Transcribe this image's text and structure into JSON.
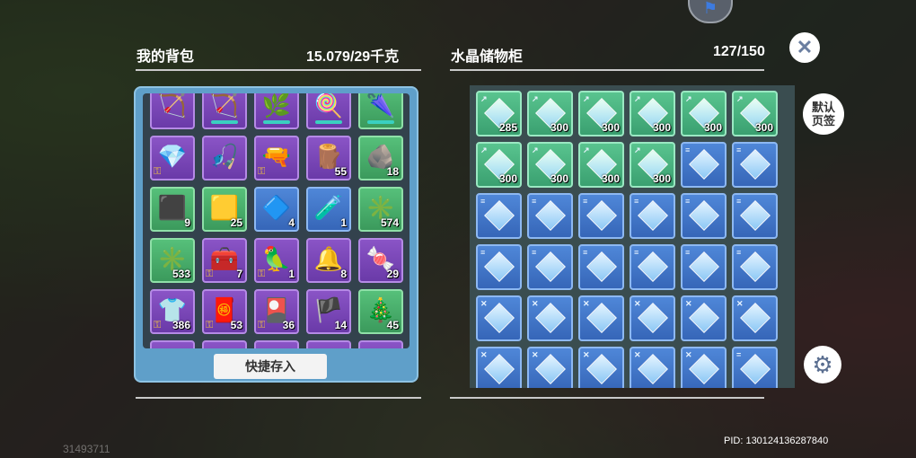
{
  "backpack": {
    "title": "我的背包",
    "weight": "15.079/29千克",
    "quick_store_label": "快捷存入",
    "items": [
      {
        "icon": "🏹",
        "color": "purple",
        "count": "",
        "bar": false
      },
      {
        "icon": "🏹",
        "color": "purple",
        "count": "",
        "bar": true
      },
      {
        "icon": "🌿",
        "color": "purple",
        "count": "",
        "bar": true
      },
      {
        "icon": "🍭",
        "color": "purple",
        "count": "",
        "bar": true
      },
      {
        "icon": "🌂",
        "color": "green",
        "count": "",
        "bar": true
      },
      {
        "icon": "💎",
        "color": "purple",
        "count": "",
        "bar": false,
        "lock": true
      },
      {
        "icon": "🎣",
        "color": "purple",
        "count": "",
        "bar": false
      },
      {
        "icon": "🔫",
        "color": "purple",
        "count": "",
        "bar": false,
        "lock": true
      },
      {
        "icon": "🪵",
        "color": "purple",
        "count": "55",
        "bar": false
      },
      {
        "icon": "🪨",
        "color": "green",
        "count": "18",
        "bar": false
      },
      {
        "icon": "⬛",
        "color": "green",
        "count": "9",
        "bar": false
      },
      {
        "icon": "🟨",
        "color": "green",
        "count": "25",
        "bar": false
      },
      {
        "icon": "🔷",
        "color": "blue",
        "count": "4",
        "bar": false
      },
      {
        "icon": "🧪",
        "color": "blue",
        "count": "1",
        "bar": false
      },
      {
        "icon": "✳️",
        "color": "green",
        "count": "574",
        "bar": false
      },
      {
        "icon": "✳️",
        "color": "green",
        "count": "533",
        "bar": false
      },
      {
        "icon": "🧰",
        "color": "purple",
        "count": "7",
        "bar": false,
        "lock": true
      },
      {
        "icon": "🦜",
        "color": "purple",
        "count": "1",
        "bar": false,
        "lock": true
      },
      {
        "icon": "🔔",
        "color": "purple",
        "count": "8",
        "bar": false
      },
      {
        "icon": "🍬",
        "color": "purple",
        "count": "29",
        "bar": false
      },
      {
        "icon": "👕",
        "color": "purple",
        "count": "386",
        "bar": false,
        "lock": true
      },
      {
        "icon": "🧧",
        "color": "purple",
        "count": "53",
        "bar": false,
        "lock": true
      },
      {
        "icon": "🎴",
        "color": "purple",
        "count": "36",
        "bar": false,
        "lock": true
      },
      {
        "icon": "🏴",
        "color": "purple",
        "count": "14",
        "bar": false
      },
      {
        "icon": "🎄",
        "color": "green",
        "count": "45",
        "bar": false
      }
    ]
  },
  "storage": {
    "title": "水晶储物柜",
    "capacity": "127/150",
    "tab_label_1": "默认",
    "tab_label_2": "页签",
    "items": [
      {
        "color": "teal",
        "count": "285",
        "tag": "↗"
      },
      {
        "color": "teal",
        "count": "300",
        "tag": "↗"
      },
      {
        "color": "teal",
        "count": "300",
        "tag": "↗"
      },
      {
        "color": "teal",
        "count": "300",
        "tag": "↗"
      },
      {
        "color": "teal",
        "count": "300",
        "tag": "↗"
      },
      {
        "color": "teal",
        "count": "300",
        "tag": "↗"
      },
      {
        "color": "teal",
        "count": "300",
        "tag": "↗"
      },
      {
        "color": "teal",
        "count": "300",
        "tag": "↗"
      },
      {
        "color": "teal",
        "count": "300",
        "tag": "↗"
      },
      {
        "color": "teal",
        "count": "300",
        "tag": "↗"
      },
      {
        "color": "blue",
        "count": "",
        "tag": "≡"
      },
      {
        "color": "blue",
        "count": "",
        "tag": "≡"
      },
      {
        "color": "blue",
        "count": "",
        "tag": "≡"
      },
      {
        "color": "blue",
        "count": "",
        "tag": "≡"
      },
      {
        "color": "blue",
        "count": "",
        "tag": "≡"
      },
      {
        "color": "blue",
        "count": "",
        "tag": "≡"
      },
      {
        "color": "blue",
        "count": "",
        "tag": "≡"
      },
      {
        "color": "blue",
        "count": "",
        "tag": "≡"
      },
      {
        "color": "blue",
        "count": "",
        "tag": "≡"
      },
      {
        "color": "blue",
        "count": "",
        "tag": "≡"
      },
      {
        "color": "blue",
        "count": "",
        "tag": "≡"
      },
      {
        "color": "blue",
        "count": "",
        "tag": "≡"
      },
      {
        "color": "blue",
        "count": "",
        "tag": "≡"
      },
      {
        "color": "blue",
        "count": "",
        "tag": "≡"
      },
      {
        "color": "blue",
        "count": "",
        "tag": "✕"
      },
      {
        "color": "blue",
        "count": "",
        "tag": "✕"
      },
      {
        "color": "blue",
        "count": "",
        "tag": "✕"
      },
      {
        "color": "blue",
        "count": "",
        "tag": "✕"
      },
      {
        "color": "blue",
        "count": "",
        "tag": "✕"
      },
      {
        "color": "blue",
        "count": "",
        "tag": "✕"
      },
      {
        "color": "blue",
        "count": "",
        "tag": "✕"
      },
      {
        "color": "blue",
        "count": "",
        "tag": "✕"
      },
      {
        "color": "blue",
        "count": "",
        "tag": "✕"
      },
      {
        "color": "blue",
        "count": "",
        "tag": "✕"
      },
      {
        "color": "blue",
        "count": "",
        "tag": "✕"
      },
      {
        "color": "blue",
        "count": "",
        "tag": "="
      }
    ]
  },
  "footer": {
    "pid": "PID: 130124136287840",
    "background_number": "31493711"
  },
  "icons": {
    "close": "close-icon",
    "gear": "gear-icon",
    "top_badge": "bookmark-icon"
  }
}
